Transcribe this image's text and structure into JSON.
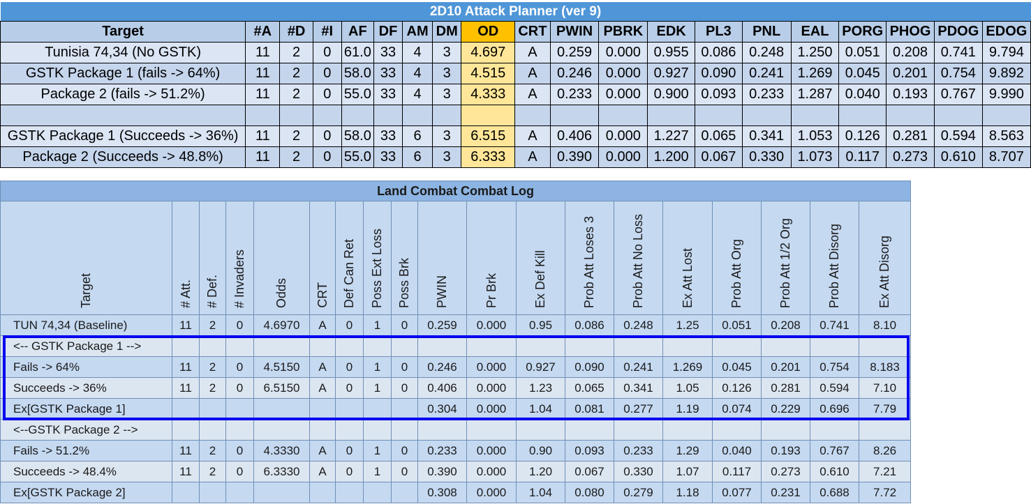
{
  "planner": {
    "title": "2D10 Attack Planner (ver 9)",
    "headers": [
      "Target",
      "#A",
      "#D",
      "#I",
      "AF",
      "DF",
      "AM",
      "DM",
      "OD",
      "CRT",
      "PWIN",
      "PBRK",
      "EDK",
      "PL3",
      "PNL",
      "EAL",
      "PORG",
      "PHOG",
      "PDOG",
      "EDOG"
    ],
    "rows": [
      [
        "Tunisia 74,34 (No GSTK)",
        "11",
        "2",
        "0",
        "61.0",
        "33",
        "4",
        "3",
        "4.697",
        "A",
        "0.259",
        "0.000",
        "0.955",
        "0.086",
        "0.248",
        "1.250",
        "0.051",
        "0.208",
        "0.741",
        "9.794"
      ],
      [
        "GSTK Package 1 (fails -> 64%)",
        "11",
        "2",
        "0",
        "58.0",
        "33",
        "4",
        "3",
        "4.515",
        "A",
        "0.246",
        "0.000",
        "0.927",
        "0.090",
        "0.241",
        "1.269",
        "0.045",
        "0.201",
        "0.754",
        "9.892"
      ],
      [
        "Package 2 (fails -> 51.2%)",
        "11",
        "2",
        "0",
        "55.0",
        "33",
        "4",
        "3",
        "4.333",
        "A",
        "0.233",
        "0.000",
        "0.900",
        "0.093",
        "0.233",
        "1.287",
        "0.040",
        "0.193",
        "0.767",
        "9.990"
      ],
      [
        "",
        "",
        "",
        "",
        "",
        "",
        "",
        "",
        "",
        "",
        "",
        "",
        "",
        "",
        "",
        "",
        "",
        "",
        "",
        ""
      ],
      [
        "GSTK Package 1 (Succeeds -> 36%)",
        "11",
        "2",
        "0",
        "58.0",
        "33",
        "6",
        "3",
        "6.515",
        "A",
        "0.406",
        "0.000",
        "1.227",
        "0.065",
        "0.341",
        "1.053",
        "0.126",
        "0.281",
        "0.594",
        "8.563"
      ],
      [
        "Package 2 (Succeeds -> 48.8%)",
        "11",
        "2",
        "0",
        "55.0",
        "33",
        "6",
        "3",
        "6.333",
        "A",
        "0.390",
        "0.000",
        "1.200",
        "0.067",
        "0.330",
        "1.073",
        "0.117",
        "0.273",
        "0.610",
        "8.707"
      ]
    ]
  },
  "log": {
    "title": "Land Combat Combat Log",
    "headers": [
      "Target",
      "# Att.",
      "# Def.",
      "# Invaders",
      "Odds",
      "CRT",
      "Def Can Ret",
      "Poss Ext Loss",
      "Poss Brk",
      "PWIN",
      "Pr Brk",
      "Ex Def Kill",
      "Prob Att Loses 3",
      "Prob Att No Loss",
      "Ex Att Lost",
      "Prob Att Org",
      "Prob Att 1/2 Org",
      "Prob Att Disorg",
      "Ex Att Disorg"
    ],
    "rows": [
      [
        "TUN 74,34 (Baseline)",
        "11",
        "2",
        "0",
        "4.6970",
        "A",
        "0",
        "1",
        "0",
        "0.259",
        "0.000",
        "0.95",
        "0.086",
        "0.248",
        "1.25",
        "0.051",
        "0.208",
        "0.741",
        "8.10"
      ],
      [
        "<-- GSTK Package 1 -->",
        "",
        "",
        "",
        "",
        "",
        "",
        "",
        "",
        "",
        "",
        "",
        "",
        "",
        "",
        "",
        "",
        "",
        ""
      ],
      [
        "Fails -> 64%",
        "11",
        "2",
        "0",
        "4.5150",
        "A",
        "0",
        "1",
        "0",
        "0.246",
        "0.000",
        "0.927",
        "0.090",
        "0.241",
        "1.269",
        "0.045",
        "0.201",
        "0.754",
        "8.183"
      ],
      [
        "Succeeds -> 36%",
        "11",
        "2",
        "0",
        "6.5150",
        "A",
        "0",
        "1",
        "0",
        "0.406",
        "0.000",
        "1.23",
        "0.065",
        "0.341",
        "1.05",
        "0.126",
        "0.281",
        "0.594",
        "7.10"
      ],
      [
        "Ex[GSTK Package 1]",
        "",
        "",
        "",
        "",
        "",
        "",
        "",
        "",
        "0.304",
        "0.000",
        "1.04",
        "0.081",
        "0.277",
        "1.19",
        "0.074",
        "0.229",
        "0.696",
        "7.79"
      ],
      [
        "<--GSTK Package 2 -->",
        "",
        "",
        "",
        "",
        "",
        "",
        "",
        "",
        "",
        "",
        "",
        "",
        "",
        "",
        "",
        "",
        "",
        ""
      ],
      [
        "Fails -> 51.2%",
        "11",
        "2",
        "0",
        "4.3330",
        "A",
        "0",
        "1",
        "0",
        "0.233",
        "0.000",
        "0.90",
        "0.093",
        "0.233",
        "1.29",
        "0.040",
        "0.193",
        "0.767",
        "8.26"
      ],
      [
        "Succeeds -> 48.4%",
        "11",
        "2",
        "0",
        "6.3330",
        "A",
        "0",
        "1",
        "0",
        "0.390",
        "0.000",
        "1.20",
        "0.067",
        "0.330",
        "1.07",
        "0.117",
        "0.273",
        "0.610",
        "7.21"
      ],
      [
        "Ex[GSTK Package 2]",
        "",
        "",
        "",
        "",
        "",
        "",
        "",
        "",
        "0.308",
        "0.000",
        "1.04",
        "0.080",
        "0.279",
        "1.18",
        "0.077",
        "0.231",
        "0.688",
        "7.72"
      ]
    ]
  },
  "colors": {
    "planner_title_bg": "#4f96d8",
    "od_header_bg": "#ffc000",
    "od_cell_bg": "#ffe699",
    "highlight_border": "#0000ee"
  }
}
